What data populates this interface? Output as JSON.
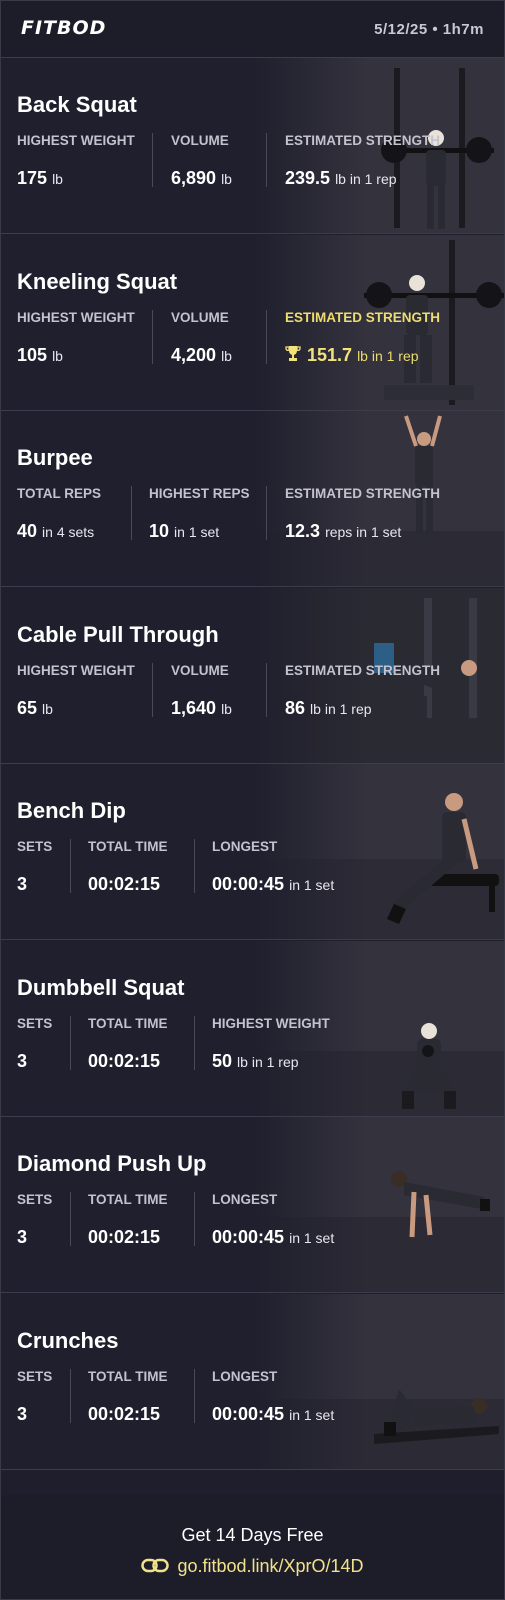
{
  "header": {
    "logo": "FITBOD",
    "meta": "5/12/25 • 1h7m"
  },
  "colors": {
    "background": "#1f1e2c",
    "highlight": "#f2e27a",
    "label": "#c3c2cd"
  },
  "exercises": [
    {
      "name": "Back Squat",
      "image": "barbell-back-squat-photo",
      "stats": [
        {
          "label": "HIGHEST WEIGHT",
          "value": "175",
          "unit": "lb"
        },
        {
          "label": "VOLUME",
          "value": "6,890",
          "unit": "lb"
        },
        {
          "label": "ESTIMATED STRENGTH",
          "value": "239.5",
          "unit": "lb in 1 rep"
        }
      ]
    },
    {
      "name": "Kneeling Squat",
      "image": "kneeling-squat-photo",
      "stats": [
        {
          "label": "HIGHEST WEIGHT",
          "value": "105",
          "unit": "lb"
        },
        {
          "label": "VOLUME",
          "value": "4,200",
          "unit": "lb"
        },
        {
          "label": "ESTIMATED STRENGTH",
          "value": "151.7",
          "unit": "lb in 1 rep",
          "highlight": true,
          "icon": "trophy-icon"
        }
      ]
    },
    {
      "name": "Burpee",
      "image": "burpee-photo",
      "stats": [
        {
          "label": "TOTAL REPS",
          "value": "40",
          "unit": "in 4 sets"
        },
        {
          "label": "HIGHEST REPS",
          "value": "10",
          "unit": "in 1 set"
        },
        {
          "label": "ESTIMATED STRENGTH",
          "value": "12.3",
          "unit": "reps in 1 set"
        }
      ]
    },
    {
      "name": "Cable Pull Through",
      "image": "cable-pull-through-photo",
      "stats": [
        {
          "label": "HIGHEST WEIGHT",
          "value": "65",
          "unit": "lb"
        },
        {
          "label": "VOLUME",
          "value": "1,640",
          "unit": "lb"
        },
        {
          "label": "ESTIMATED STRENGTH",
          "value": "86",
          "unit": "lb in 1 rep"
        }
      ]
    },
    {
      "name": "Bench Dip",
      "image": "bench-dip-photo",
      "stats": [
        {
          "label": "SETS",
          "value": "3",
          "unit": ""
        },
        {
          "label": "TOTAL TIME",
          "value": "00:02:15",
          "unit": ""
        },
        {
          "label": "LONGEST",
          "value": "00:00:45",
          "unit": "in 1 set"
        }
      ]
    },
    {
      "name": "Dumbbell Squat",
      "image": "dumbbell-squat-photo",
      "stats": [
        {
          "label": "SETS",
          "value": "3",
          "unit": ""
        },
        {
          "label": "TOTAL TIME",
          "value": "00:02:15",
          "unit": ""
        },
        {
          "label": "HIGHEST WEIGHT",
          "value": "50",
          "unit": "lb in 1 rep"
        }
      ]
    },
    {
      "name": "Diamond Push Up",
      "image": "diamond-push-up-photo",
      "stats": [
        {
          "label": "SETS",
          "value": "3",
          "unit": ""
        },
        {
          "label": "TOTAL TIME",
          "value": "00:02:15",
          "unit": ""
        },
        {
          "label": "LONGEST",
          "value": "00:00:45",
          "unit": "in 1 set"
        }
      ]
    },
    {
      "name": "Crunches",
      "image": "crunches-photo",
      "stats": [
        {
          "label": "SETS",
          "value": "3",
          "unit": ""
        },
        {
          "label": "TOTAL TIME",
          "value": "00:02:15",
          "unit": ""
        },
        {
          "label": "LONGEST",
          "value": "00:00:45",
          "unit": "in 1 set"
        }
      ]
    }
  ],
  "footer": {
    "cta": "Get 14 Days Free",
    "link": "go.fitbod.link/XprO/14D",
    "icon": "link-icon"
  }
}
